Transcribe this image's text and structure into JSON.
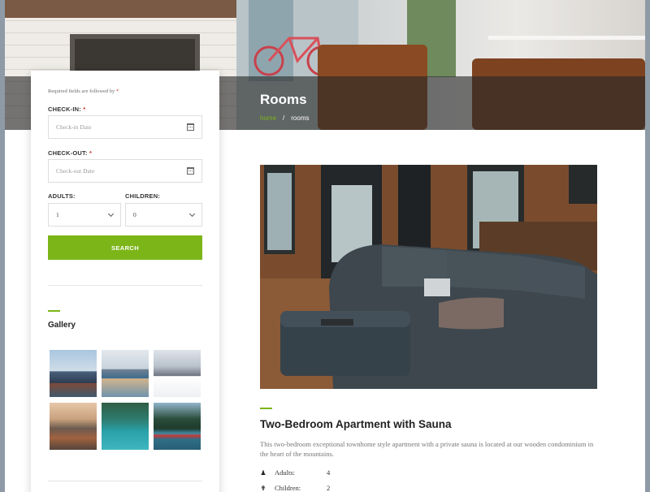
{
  "hero": {
    "title": "Rooms",
    "breadcrumb": {
      "home": "home",
      "separator": "/",
      "current": "rooms"
    }
  },
  "booking": {
    "required_note": "Required fields are followed by",
    "required_star": "*",
    "checkin_label": "CHECK-IN:",
    "checkin_placeholder": "Check-in Date",
    "checkout_label": "CHECK-OUT:",
    "checkout_placeholder": "Check-out Date",
    "adults_label": "ADULTS:",
    "adults_value": "1",
    "children_label": "CHILDREN:",
    "children_value": "0",
    "search_label": "SEARCH",
    "calendar_icon": "calendar-icon",
    "accent_color": "#7cb518"
  },
  "gallery": {
    "title": "Gallery",
    "thumbnails": [
      "lake-cabins-mountains",
      "dock-boats-mountains",
      "person-snowy-peaks",
      "cliff-village-sunset",
      "kayak-turquoise-lake",
      "red-canoe-forest-lake"
    ]
  },
  "room": {
    "title": "Two-Bedroom Apartment with Sauna",
    "description": "This two-bedroom exceptional townhome style apartment with a private sauna is located at our wooden condominium in the heart of the mountains.",
    "specs": [
      {
        "icon": "user-icon",
        "label": "Adults:",
        "value": "4"
      },
      {
        "icon": "child-icon",
        "label": "Children:",
        "value": "2"
      }
    ]
  }
}
